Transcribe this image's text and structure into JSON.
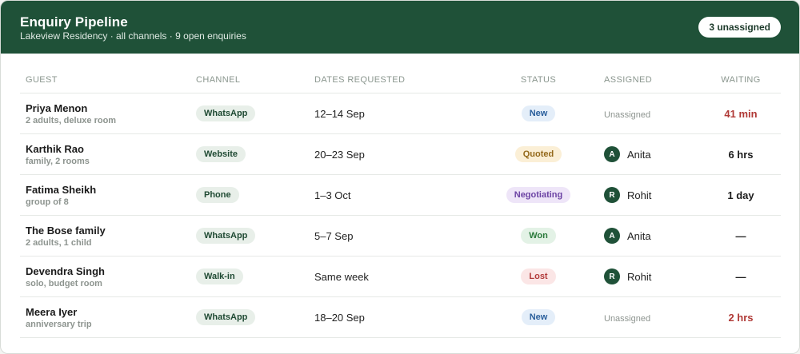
{
  "header": {
    "title": "Enquiry Pipeline",
    "subtitle": "Lakeview Residency · all channels · 9 open enquiries",
    "badge": "3 unassigned"
  },
  "columns": [
    "GUEST",
    "CHANNEL",
    "DATES REQUESTED",
    "STATUS",
    "ASSIGNED",
    "WAITING"
  ],
  "rows": [
    {
      "name": "Priya Menon",
      "detail": "2 adults, deluxe room",
      "channel": "WhatsApp",
      "dates": "12–14 Sep",
      "status": "New",
      "status_kind": "new",
      "assigned": "Unassigned",
      "initial": "",
      "waiting": "41 min",
      "waiting_alert": true
    },
    {
      "name": "Karthik Rao",
      "detail": "family, 2 rooms",
      "channel": "Website",
      "dates": "20–23 Sep",
      "status": "Quoted",
      "status_kind": "quoted",
      "assigned": "Anita",
      "initial": "A",
      "waiting": "6 hrs",
      "waiting_alert": false
    },
    {
      "name": "Fatima Sheikh",
      "detail": "group of 8",
      "channel": "Phone",
      "dates": "1–3 Oct",
      "status": "Negotiating",
      "status_kind": "neg",
      "assigned": "Rohit",
      "initial": "R",
      "waiting": "1 day",
      "waiting_alert": false
    },
    {
      "name": "The Bose family",
      "detail": "2 adults, 1 child",
      "channel": "WhatsApp",
      "dates": "5–7 Sep",
      "status": "Won",
      "status_kind": "won",
      "assigned": "Anita",
      "initial": "A",
      "waiting": "—",
      "waiting_alert": false
    },
    {
      "name": "Devendra Singh",
      "detail": "solo, budget room",
      "channel": "Walk-in",
      "dates": "Same week",
      "status": "Lost",
      "status_kind": "lost",
      "assigned": "Rohit",
      "initial": "R",
      "waiting": "—",
      "waiting_alert": false
    },
    {
      "name": "Meera Iyer",
      "detail": "anniversary trip",
      "channel": "WhatsApp",
      "dates": "18–20 Sep",
      "status": "New",
      "status_kind": "new",
      "assigned": "Unassigned",
      "initial": "",
      "waiting": "2 hrs",
      "waiting_alert": true
    }
  ],
  "colors": {
    "header_bg": "#1f5138",
    "alert": "#b03a37",
    "avatar_bg": "#1f5138"
  }
}
